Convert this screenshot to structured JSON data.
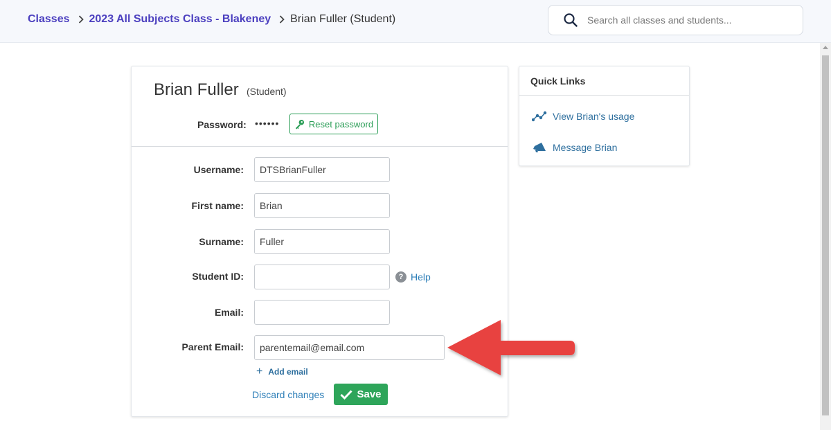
{
  "breadcrumb": {
    "items": [
      "Classes",
      "2023 All Subjects Class - Blakeney"
    ],
    "current": "Brian Fuller (Student)"
  },
  "search": {
    "placeholder": "Search all classes and students..."
  },
  "student": {
    "name": "Brian Fuller",
    "role": "(Student)",
    "password_label": "Password:",
    "password_mask": "••••••",
    "reset_label": "Reset password"
  },
  "form": {
    "fields": [
      {
        "label": "Username:",
        "value": "DTSBrianFuller"
      },
      {
        "label": "First name:",
        "value": "Brian"
      },
      {
        "label": "Surname:",
        "value": "Fuller"
      },
      {
        "label": "Student ID:",
        "value": ""
      },
      {
        "label": "Email:",
        "value": ""
      },
      {
        "label": "Parent Email:",
        "value": "parentemail@email.com"
      }
    ],
    "help_label": "Help",
    "add_email_label": "Add email",
    "discard_label": "Discard changes",
    "save_label": "Save"
  },
  "quick_links": {
    "title": "Quick Links",
    "items": [
      {
        "label": "View Brian's usage",
        "icon": "usage-graph-icon"
      },
      {
        "label": "Message Brian",
        "icon": "megaphone-icon"
      }
    ]
  },
  "colors": {
    "accent": "#4b3fbf",
    "link": "#2e7fb8",
    "save": "#2ea55a",
    "annotation_arrow": "#e8423f"
  }
}
